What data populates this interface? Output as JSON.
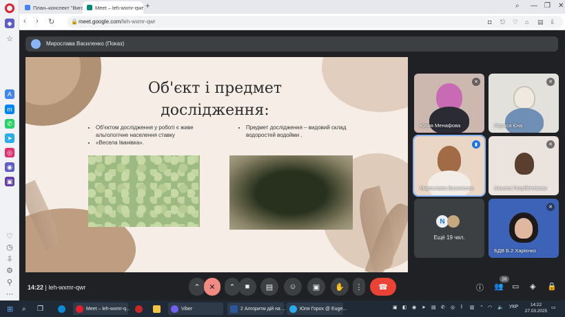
{
  "browser": {
    "tabs": [
      {
        "label": "План–конспект \"Виготов",
        "favicon_color": "#4285f4",
        "active": false
      },
      {
        "label": "Meet – leh-wxmr-qwr",
        "favicon_color": "#00897b",
        "active": true
      }
    ],
    "new_tab": "+",
    "url_domain": "meet.google.com",
    "url_path": "/leh-wxmr-qwr"
  },
  "meet": {
    "presenter_label": "Мирослава Василенко (Показ)",
    "slide": {
      "title_line1": "Об'єкт і предмет",
      "title_line2": "дослідження:",
      "left_bullet_1": "Об'єктом дослідження у роботі є живе альгологічне населення ставку",
      "left_bullet_2": "«Весела Іванівка».",
      "right_bullet_1": "Предмет дослідження – видовий склад водоростей водойми ."
    },
    "participants": [
      {
        "name": "Юлия Менафова"
      },
      {
        "name": "Лариса Єна"
      },
      {
        "name": "Мирослава Василенко"
      },
      {
        "name": "Альона Голубятнікова"
      },
      {
        "more": "Ещё 19 чел.",
        "initial": "N"
      },
      {
        "name": "БДВ Б.2 Харієнко"
      }
    ],
    "time": "14:22",
    "meeting_code": "leh-wxmr-qwr",
    "participant_count": "26"
  },
  "taskbar": {
    "items": [
      {
        "label": "Meet – leh-wxmr-q...",
        "color": "#e3202f"
      },
      {
        "label": "Viber",
        "color": "#7360f2"
      },
      {
        "label": "2 Алгоритм дій на ...",
        "color": "#2b579a"
      },
      {
        "label": "Юля Горох @ Euge...",
        "color": "#2aabee"
      }
    ],
    "language": "УКР",
    "clock_time": "14:22",
    "clock_date": "27.03.2025"
  }
}
